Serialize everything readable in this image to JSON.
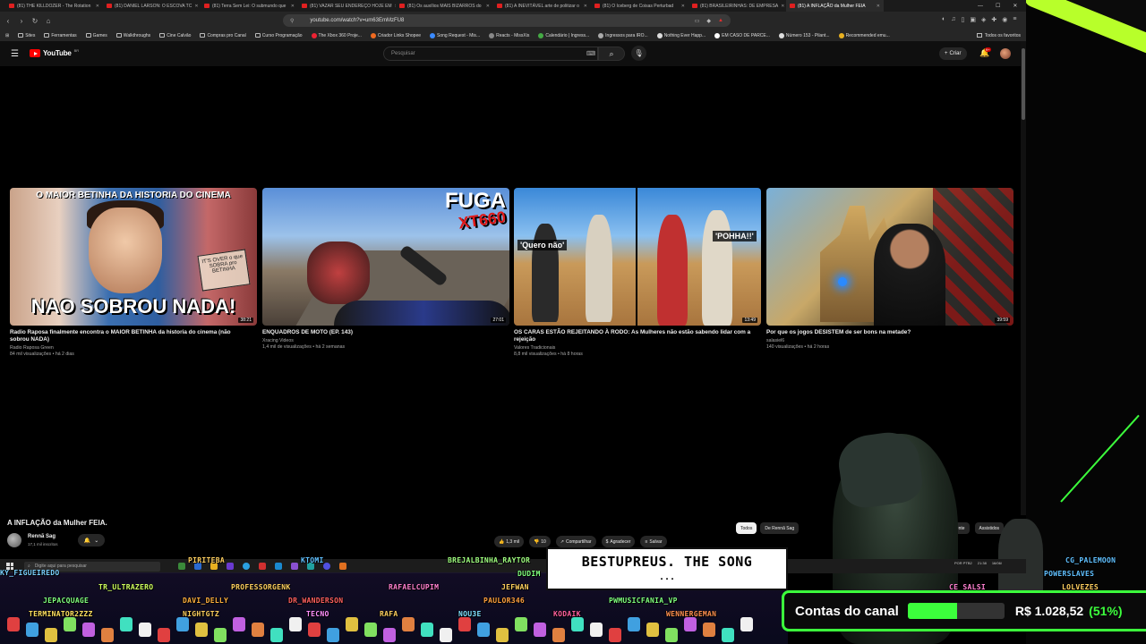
{
  "browser": {
    "tabs": [
      {
        "label": "(81) THE KILLDOZER - The Rotation"
      },
      {
        "label": "(81) DANIEL LARSON: O ESCOVA TC"
      },
      {
        "label": "(81) Terra Sem Lei: O submundo que"
      },
      {
        "label": "(81) VAZAR SEU ENDEREÇO HOJE EM"
      },
      {
        "label": "(81) Os auxílios MAIS BIZARROS do"
      },
      {
        "label": "(81) A INEVITÁVEL arte de politizar o"
      },
      {
        "label": "(81) O Iceberg de Coisas Perturbad"
      },
      {
        "label": "(81) BRASILEIRINHAS: DE EMPRESA"
      },
      {
        "label": "(81) A INFLAÇÃO da Mulher FEIA"
      }
    ],
    "url": "youtube.com/watch?v=um63EmMzFU8",
    "bookmarks": [
      "Sites",
      "Ferramentas",
      "Games",
      "Walkthroughs",
      "Cine Calvão",
      "Compras pro Canal",
      "Curso Programação",
      "The Xbox 360 Proje...",
      "Criador Links Shopee",
      "Song Request - Mis...",
      "Reacts - MissXis",
      "Calendário | Ingress...",
      "Ingressos para IRO...",
      "Nothing Ever Happ...",
      "EM CASO DE PARCE...",
      "Número 153 - Pilant...",
      "Recommended emu..."
    ],
    "bookmarks_all": "Todos os favoritos"
  },
  "youtube": {
    "logo": "YouTube",
    "country": "BR",
    "search_placeholder": "Pesquisar",
    "create_label": "Criar",
    "notif_count": "9+"
  },
  "videos": [
    {
      "title": "Radio Raposa finalmente encontra o MAIOR BETINHA da historia do cinema (não sobrou NADA)",
      "channel": "Radio Raposa Green",
      "meta": "84 mil visualizações • há 2 dias",
      "duration": "38:21",
      "thumb_caption": "O MAIOR BETINHA DA HISTORIA DO CINEMA",
      "thumb_big": "NAO SOBROU NADA!",
      "thumb_stamp": "IT'S OVER o que SOBRA pro BETINHA"
    },
    {
      "title": "ENQUADROS DE MOTO (EP. 143)",
      "channel": "Xracing Videos",
      "meta": "1,4 mil de visualizações • há 2 semanas",
      "duration": "27:01",
      "thumb_big": "FUGA",
      "thumb_sub": "XT660"
    },
    {
      "title": "OS CARAS ESTÃO REJEITANDO À RODO: As Mulheres não estão sabendo lidar com a rejeição",
      "channel": "Valores Tradicionais",
      "meta": "8,8 mil visualizações • há 8 horas",
      "duration": "13:49",
      "thumb_left": "'Quero não'",
      "thumb_right": "'POHHA!!'"
    },
    {
      "title": "Por que os jogos DESISTEM de ser bons na metade?",
      "channel": "salasiel6",
      "meta": "140 visualizações • há 2 horas",
      "duration": "39:59"
    }
  ],
  "watch": {
    "title": "A INFLAÇÃO da Mulher FEIA.",
    "channel": "Rennã Sag",
    "subs": "17,1 mil inscritos",
    "likes": "1,3 mil",
    "dislike": "10",
    "share": "Compartilhar",
    "thanks": "Agradecer",
    "save": "Salvar",
    "chips": [
      "Todos",
      "De Rennã Sag"
    ],
    "chips_right": [
      "Recentemente",
      "Assistidos"
    ]
  },
  "taskbar": {
    "search_placeholder": "Digite aqui para pesquisar",
    "lang": "POR PTB2",
    "time": "21:38",
    "date": "16/06/"
  },
  "stream": {
    "song_line1": "BESTUPREUS. THE SONG",
    "song_line2": "...",
    "goal_label": "Contas do canal",
    "goal_amount": "R$ 1.028,52",
    "goal_percent": "(51%)",
    "goal_fraction": 0.51,
    "chat_names": [
      "KY_FIGUEIREDO",
      "TR_ULTRAZERO",
      "PROFESSORGENK",
      "RAFAELCUPIM",
      "PIRITEBA",
      "KTOMI",
      "BREJALBINHA_RAYTOR",
      "JEPACQUAGE",
      "TERMINATOR2ZZZ",
      "DAVI_DELLY",
      "DR_WANDERSON",
      "NIGHTGTZ",
      "TECNO",
      "RAFA",
      "NOU3E",
      "PAULOR346",
      "KODAIK",
      "PWMUSICFANIA_VP",
      "WENNERGEMAN",
      "JEFWAN",
      "CG_PALEMOON",
      "POWERSLAVES",
      "LOLVEZES",
      "DUDIM",
      "CE_SALSI"
    ]
  },
  "colors": {
    "accent": "#3cff3c",
    "youtube_red": "#ff0000",
    "neon": "#b8ff2a"
  }
}
